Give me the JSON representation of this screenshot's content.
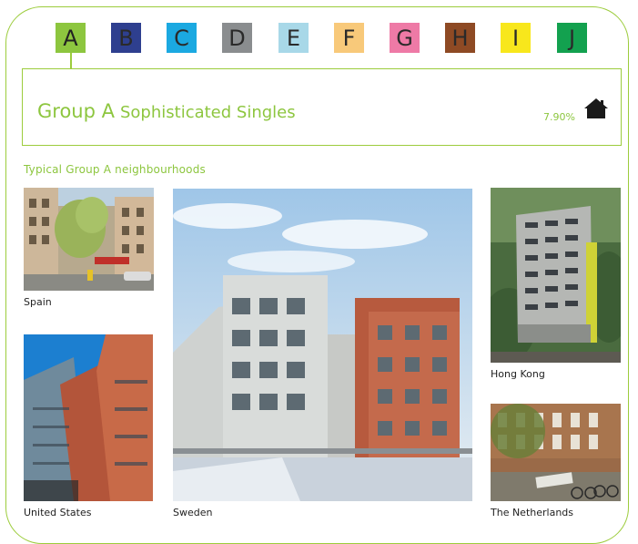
{
  "tabs": [
    {
      "label": "A",
      "color": "#8dc63f",
      "active": true
    },
    {
      "label": "B",
      "color": "#2e3f8f"
    },
    {
      "label": "C",
      "color": "#1ba9e1"
    },
    {
      "label": "D",
      "color": "#8a8d8f"
    },
    {
      "label": "E",
      "color": "#a8d8e8"
    },
    {
      "label": "F",
      "color": "#f8c97a"
    },
    {
      "label": "G",
      "color": "#ee7aa6"
    },
    {
      "label": "H",
      "color": "#8e4a24"
    },
    {
      "label": "I",
      "color": "#f8e71c"
    },
    {
      "label": "J",
      "color": "#13a14f"
    }
  ],
  "header": {
    "group": "Group A",
    "subtitle": "Sophisticated Singles",
    "percent": "7.90%",
    "icon": "house-icon"
  },
  "section_title": "Typical Group A neighbourhoods",
  "photos": {
    "spain": "Spain",
    "us": "United States",
    "sweden": "Sweden",
    "hongkong": "Hong Kong",
    "netherlands": "The Netherlands"
  },
  "accent_color": "#8dc63f"
}
